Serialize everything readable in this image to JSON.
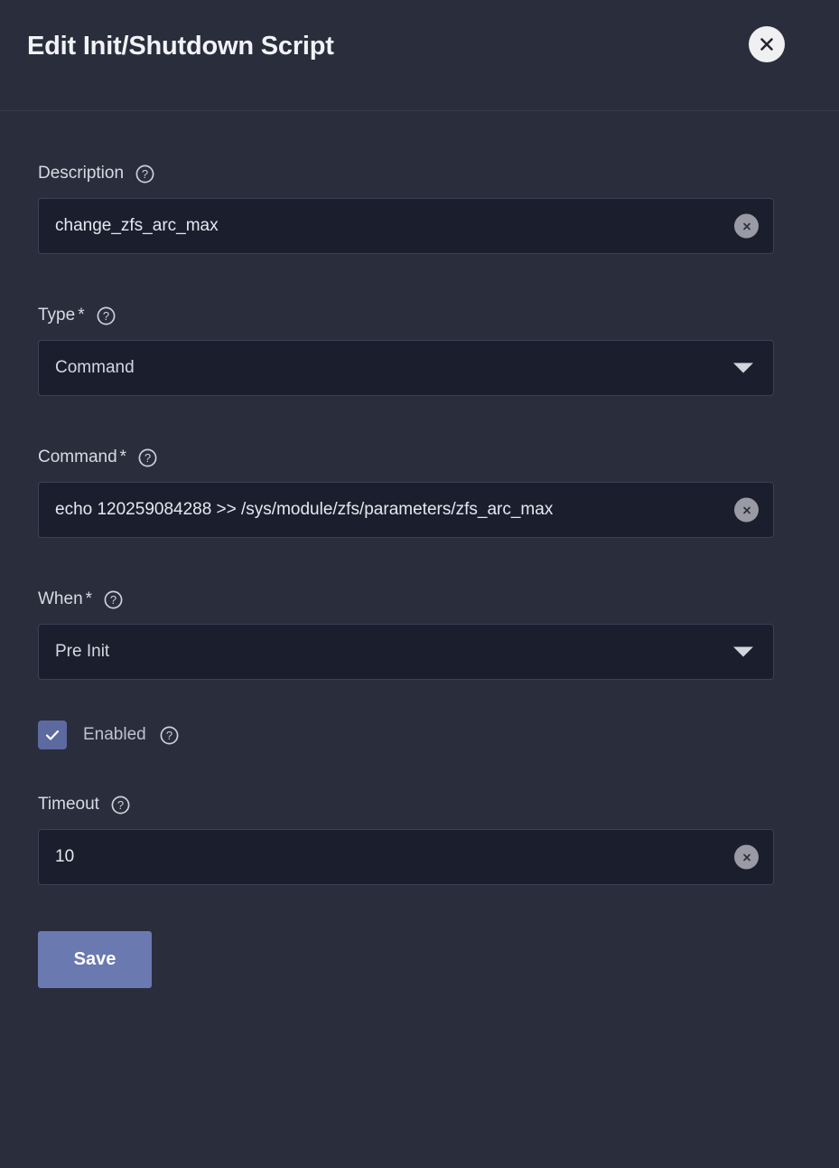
{
  "header": {
    "title": "Edit Init/Shutdown Script",
    "close_icon": "close-icon"
  },
  "form": {
    "help_icon": "help-circle-icon",
    "required_marker": "*",
    "fields": {
      "description": {
        "label": "Description",
        "required": false,
        "value": "change_zfs_arc_max",
        "placeholder": "",
        "control": "text-input",
        "clear_icon": "clear-circle-icon"
      },
      "type": {
        "label": "Type",
        "required": true,
        "value": "Command",
        "control": "select",
        "caret_icon": "chevron-down-icon"
      },
      "command": {
        "label": "Command",
        "required": true,
        "value": "echo 120259084288 >> /sys/module/zfs/parameters/zfs_arc_max",
        "placeholder": "",
        "control": "text-input",
        "clear_icon": "clear-circle-icon"
      },
      "when": {
        "label": "When",
        "required": true,
        "value": "Pre Init",
        "control": "select",
        "caret_icon": "chevron-down-icon"
      },
      "enabled": {
        "label": "Enabled",
        "checked": true,
        "control": "checkbox",
        "check_icon": "checkmark-icon"
      },
      "timeout": {
        "label": "Timeout",
        "required": false,
        "value": "10",
        "placeholder": "",
        "control": "text-input",
        "clear_icon": "clear-circle-icon"
      }
    }
  },
  "actions": {
    "save_label": "Save"
  },
  "colors": {
    "page_background": "#2a2d3b",
    "input_background": "#1b1e2d",
    "input_border": "#3b4055",
    "accent": "#6a79b0",
    "checkbox_fill": "#5c6aa0",
    "title_text": "#f2f3f7",
    "label_text": "#d8dae3",
    "clear_icon_fill": "#9a9aa4",
    "divider": "#353949"
  }
}
